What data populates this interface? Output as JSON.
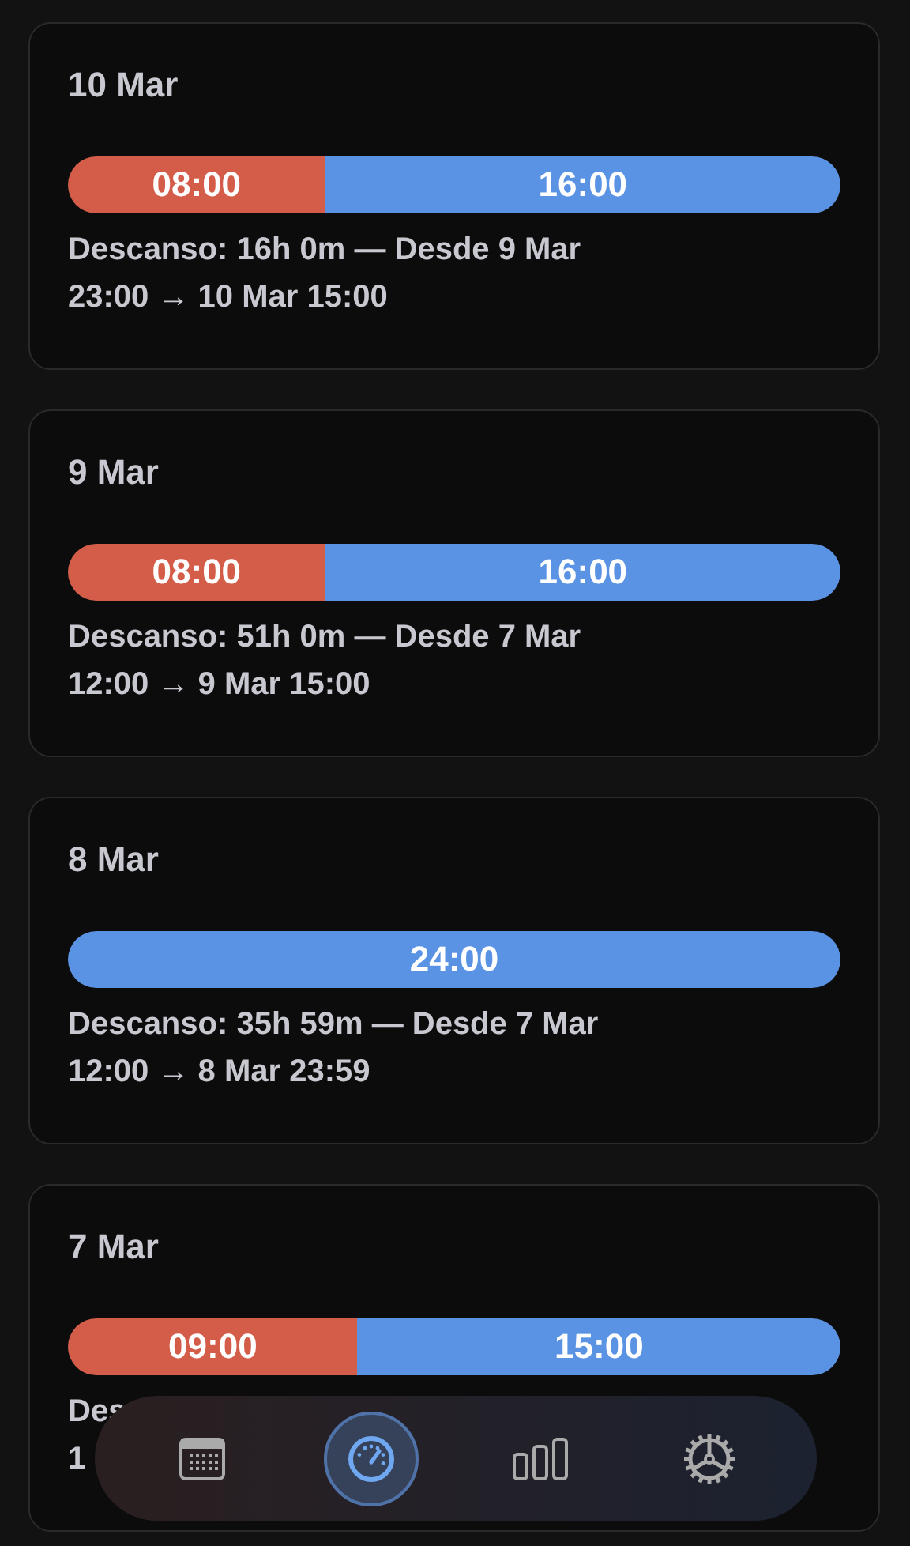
{
  "days": [
    {
      "date": "10 Mar",
      "segments": [
        {
          "label": "08:00",
          "level": 0.333,
          "color": "#d45d4a"
        },
        {
          "label": "16:00",
          "level": 0.667,
          "color": "#5b93e4"
        }
      ],
      "detail": [
        "Descanso: 16h 0m — Desde 9 Mar",
        "23:00 → 10 Mar 15:00"
      ]
    },
    {
      "date": "9 Mar",
      "segments": [
        {
          "label": "08:00",
          "level": 0.333,
          "color": "#d45d4a"
        },
        {
          "label": "16:00",
          "level": 0.667,
          "color": "#5b93e4"
        }
      ],
      "detail": [
        "Descanso: 51h 0m — Desde 7 Mar",
        "12:00 → 9 Mar 15:00"
      ]
    },
    {
      "date": "8 Mar",
      "segments": [
        {
          "label": "24:00",
          "level": 1,
          "color": "#5b93e4"
        }
      ],
      "detail": [
        "Descanso: 35h 59m — Desde 7 Mar",
        "12:00 → 8 Mar 23:59"
      ]
    },
    {
      "date": "7 Mar",
      "segments": [
        {
          "label": "09:00",
          "level": 0.375,
          "color": "#d45d4a"
        },
        {
          "label": "15:00",
          "level": 0.625,
          "color": "#5b93e4"
        }
      ],
      "detail": [
        "Des",
        "1"
      ]
    }
  ],
  "nav": [
    {
      "kind": "calendar",
      "selected": false
    },
    {
      "kind": "gauge",
      "selected": true
    },
    {
      "kind": "stats",
      "selected": false
    },
    {
      "kind": "settings",
      "selected": false
    }
  ]
}
